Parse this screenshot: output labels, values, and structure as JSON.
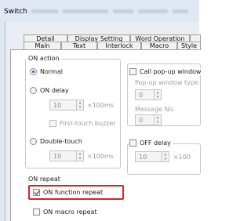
{
  "window": {
    "title": "Switch"
  },
  "tabs": {
    "row1": [
      "Detail",
      "Display Setting",
      "Word Operation",
      ""
    ],
    "row2": [
      "Main",
      "Text",
      "Interlock",
      "Macro",
      "Style"
    ]
  },
  "on_action": {
    "label": "ON action",
    "normal": "Normal",
    "on_delay": "ON delay",
    "delay_value": "10",
    "delay_unit": "×100ms",
    "first_touch_buzzer": "First-touch buzzer",
    "double_touch": "Double-touch",
    "double_touch_value": "10",
    "double_touch_unit": "×100ms"
  },
  "popup": {
    "call_popup_window": "Call pop-up window",
    "popup_window_type": "Pop-up window type",
    "popup_window_value": "0",
    "message_no_label": "Message No.",
    "message_no_value": "0"
  },
  "off_delay": {
    "label": "OFF delay",
    "value": "10",
    "unit": "×100"
  },
  "on_repeat": {
    "label": "ON repeat",
    "on_function_repeat": "ON function repeat",
    "on_macro_repeat": "ON macro repeat"
  },
  "state": {
    "normal_selected": true,
    "on_function_repeat_checked": true,
    "on_macro_repeat_checked": false,
    "call_popup_checked": false,
    "off_delay_checked": false
  },
  "colors": {
    "highlight": "#e0201e",
    "radio_dot": "#1d5fbf"
  }
}
